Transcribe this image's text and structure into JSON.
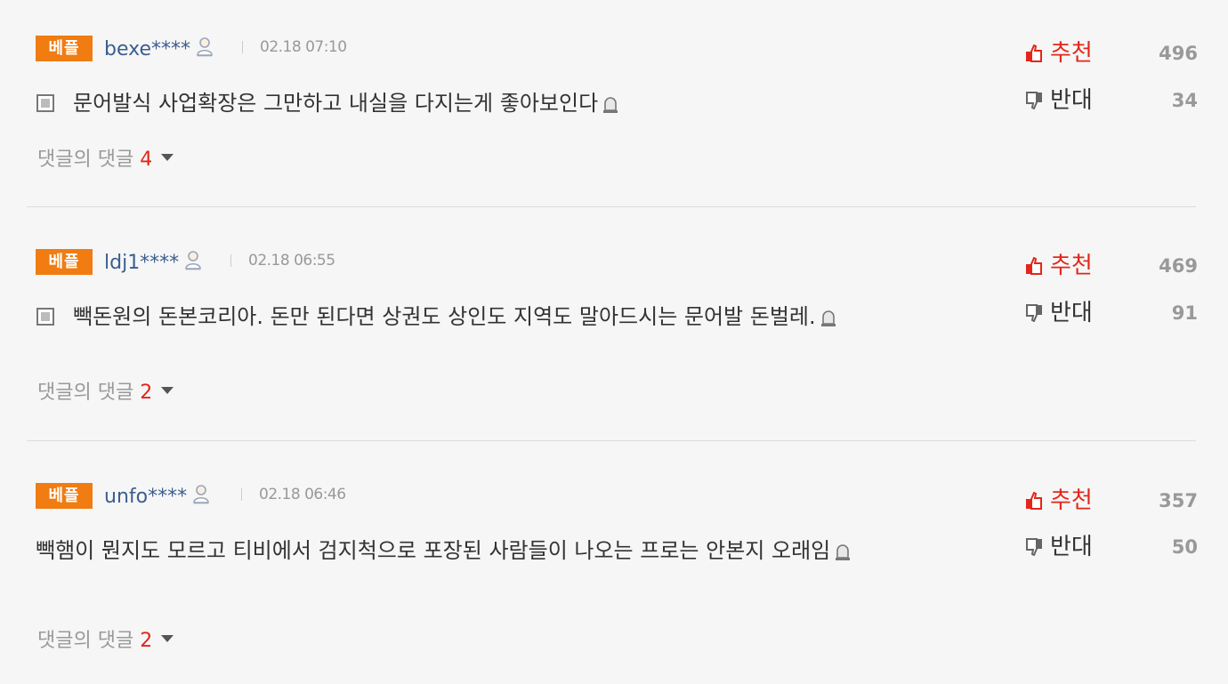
{
  "comments": [
    {
      "badge": "베플",
      "user": "bexe****",
      "date": "02.18 07:10",
      "text": "문어발식 사업확장은 그만하고 내실을 다지는게 좋아보인다",
      "replies_label": "댓글의 댓글",
      "replies_count": "4",
      "up_label": "추천",
      "up_count": "496",
      "down_label": "반대",
      "down_count": "34"
    },
    {
      "badge": "베플",
      "user": "ldj1****",
      "date": "02.18 06:55",
      "text": "빽돈원의 돈본코리아. 돈만 된다면 상권도 상인도 지역도 말아드시는 문어발 돈벌레.",
      "replies_label": "댓글의 댓글",
      "replies_count": "2",
      "up_label": "추천",
      "up_count": "469",
      "down_label": "반대",
      "down_count": "91"
    },
    {
      "badge": "베플",
      "user": "unfo****",
      "date": "02.18 06:46",
      "text": "빽햄이 뭔지도 모르고 티비에서 검지척으로 포장된 사람들이 나오는 프로는 안본지 오래임",
      "replies_label": "댓글의 댓글",
      "replies_count": "2",
      "up_label": "추천",
      "up_count": "357",
      "down_label": "반대",
      "down_count": "50"
    }
  ],
  "colors": {
    "badge_bg": "#f07c12",
    "username": "#3b5f8e",
    "accent_red": "#e3261b",
    "muted": "#999999",
    "body_text": "#333333"
  },
  "icons": {
    "user": "user-icon",
    "memo": "memo-icon",
    "report": "report-flag-icon",
    "thumbs_up": "thumbs-up-icon",
    "thumbs_down": "thumbs-down-icon",
    "expand": "caret-down-icon"
  }
}
